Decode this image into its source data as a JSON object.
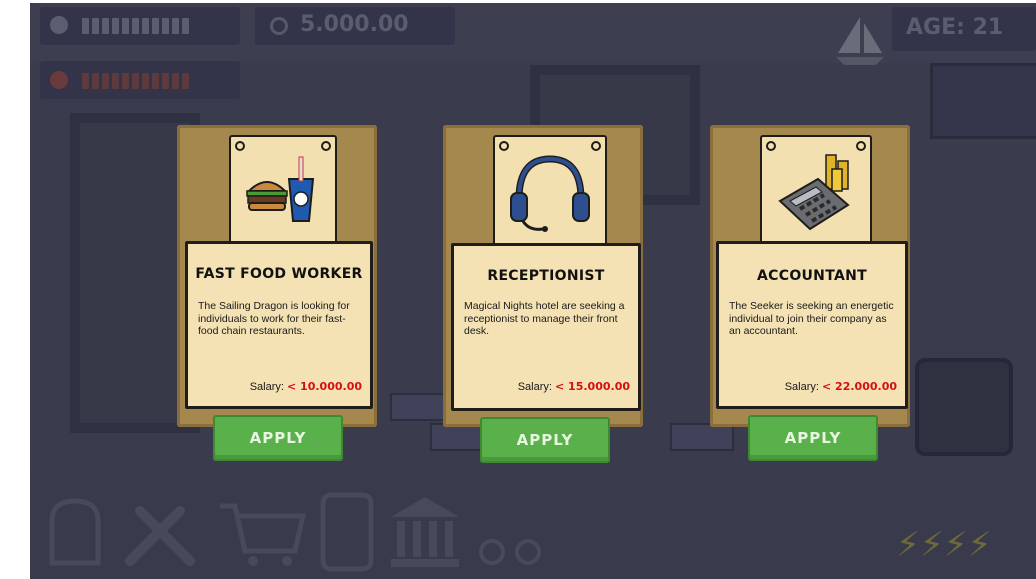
{
  "hud": {
    "money": "5.000.00",
    "age": "AGE: 21",
    "health_bar_segments": 11,
    "happiness_bar_segments": 11
  },
  "jobs": [
    {
      "title": "FAST FOOD WORKER",
      "description": "The Sailing Dragon is looking for individuals to work for their fast-food chain restaurants.",
      "salary_label": "Salary:",
      "salary_value": "< 10.000.00",
      "apply_label": "APPLY",
      "icon": "burger-and-drink-icon"
    },
    {
      "title": "RECEPTIONIST",
      "description": "Magical Nights hotel are seeking a receptionist to manage their front desk.",
      "salary_label": "Salary:",
      "salary_value": "< 15.000.00",
      "apply_label": "APPLY",
      "icon": "headset-icon"
    },
    {
      "title": "ACCOUNTANT",
      "description": "The Seeker is seeking an energetic individual to join their company as an accountant.",
      "salary_label": "Salary:",
      "salary_value": "< 22.000.00",
      "apply_label": "APPLY",
      "icon": "calculator-and-coins-icon"
    }
  ],
  "toolbar": {
    "icons": [
      "backpack-icon",
      "tools-icon",
      "shopping-cart-icon",
      "phone-icon",
      "bank-icon",
      "settings-icon"
    ]
  },
  "colors": {
    "board": "#a5884e",
    "note": "#f4e2b4",
    "apply": "#5ab04b",
    "salary": "#d40f0f",
    "overlay": "#3d3f51"
  }
}
